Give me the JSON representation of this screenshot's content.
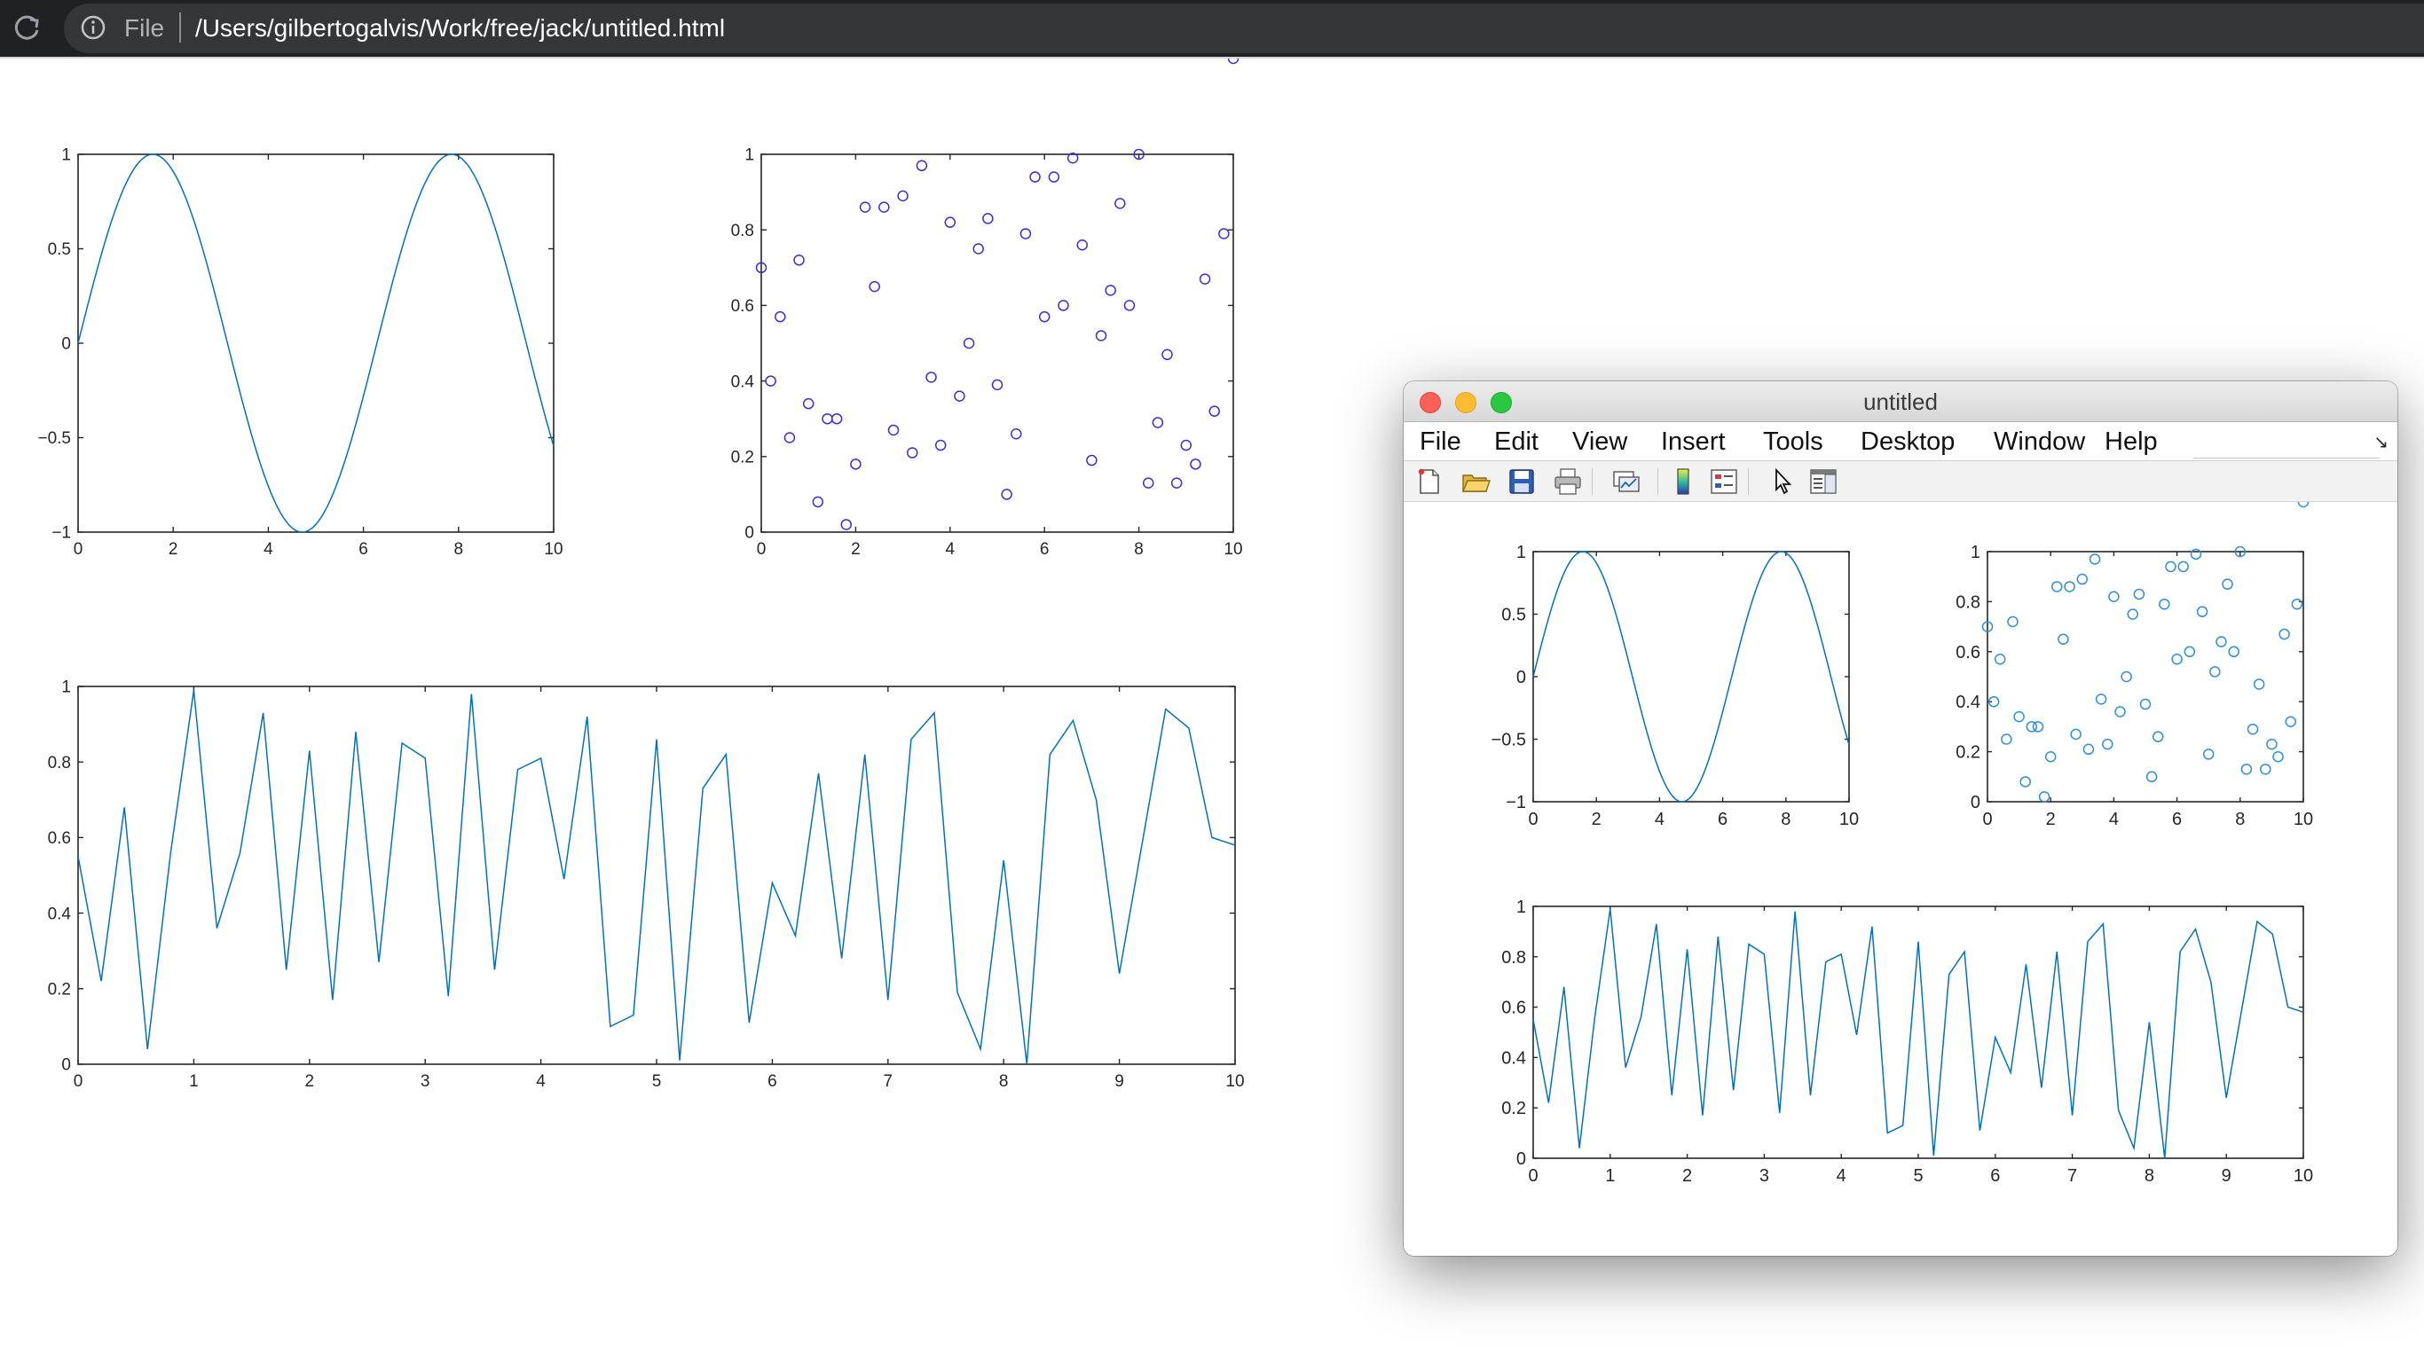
{
  "browser": {
    "scheme_label": "File",
    "url": "/Users/gilbertogalvis/Work/free/jack/untitled.html"
  },
  "figure_window": {
    "title": "untitled",
    "menu": [
      "File",
      "Edit",
      "View",
      "Insert",
      "Tools",
      "Desktop",
      "Window",
      "Help"
    ],
    "toolbar_icons": [
      "new-figure-icon",
      "open-file-icon",
      "save-icon",
      "print-icon",
      "link-plot-icon",
      "colorbar-icon",
      "legend-icon",
      "pointer-icon",
      "property-inspector-icon"
    ],
    "dock_symbol": "↘"
  },
  "colors": {
    "matlab_blue": "#0072bd",
    "scatter_html": "#3b2fd6",
    "scatter_matlab": "#2f8fd6"
  },
  "chart_data": [
    {
      "type": "line",
      "title": "",
      "xlabel": "",
      "ylabel": "",
      "xlim": [
        0,
        10
      ],
      "ylim": [
        -1,
        1
      ],
      "xticks": [
        0,
        2,
        4,
        6,
        8,
        10
      ],
      "yticks": [
        -1,
        -0.5,
        0,
        0.5,
        1
      ],
      "ytick_labels": [
        "−1",
        "−0.5",
        "0",
        "0.5",
        "1"
      ],
      "function": "y = sin(x)",
      "series": [
        {
          "x_start": 0,
          "x_end": 10,
          "samples": 201
        }
      ]
    },
    {
      "type": "scatter",
      "title": "",
      "xlabel": "",
      "ylabel": "",
      "xlim": [
        0,
        10
      ],
      "ylim": [
        0,
        1
      ],
      "xticks": [
        0,
        2,
        4,
        6,
        8,
        10
      ],
      "yticks": [
        0,
        0.2,
        0.4,
        0.6,
        0.8,
        1
      ],
      "ytick_labels": [
        "0",
        "0.2",
        "0.4",
        "0.6",
        "0.8",
        "1"
      ],
      "marker": "o",
      "x": [
        0,
        0.2,
        0.4,
        0.6,
        0.8,
        1.0,
        1.2,
        1.4,
        1.6,
        1.8,
        2.0,
        2.2,
        2.4,
        2.6,
        2.8,
        3.0,
        3.2,
        3.4,
        3.6,
        3.8,
        4.0,
        4.2,
        4.4,
        4.6,
        4.8,
        5.0,
        5.2,
        5.4,
        5.6,
        5.8,
        6.0,
        6.2,
        6.4,
        6.6,
        6.8,
        7.0,
        7.2,
        7.4,
        7.6,
        7.8,
        8.0,
        8.2,
        8.4,
        8.6,
        8.8,
        9.0,
        9.2,
        9.4,
        9.6,
        9.8,
        10.0
      ],
      "y": [
        0.7,
        0.4,
        0.57,
        0.25,
        0.72,
        0.34,
        0.08,
        0.3,
        0.3,
        0.02,
        0.18,
        0.86,
        0.65,
        0.86,
        0.27,
        0.89,
        0.21,
        0.97,
        0.41,
        0.23,
        0.82,
        0.36,
        0.5,
        0.75,
        0.83,
        0.39,
        0.1,
        0.26,
        0.79,
        0.94,
        0.57,
        0.94,
        0.6,
        0.99,
        0.76,
        0.19,
        0.52,
        0.64,
        0.87,
        0.6,
        1.0,
        0.13,
        0.29,
        0.47,
        0.13,
        0.23,
        0.18,
        0.67,
        0.32,
        0.79
      ]
    },
    {
      "type": "line",
      "title": "",
      "xlabel": "",
      "ylabel": "",
      "xlim": [
        0,
        10
      ],
      "ylim": [
        0,
        1
      ],
      "xticks": [
        0,
        1,
        2,
        3,
        4,
        5,
        6,
        7,
        8,
        9,
        10
      ],
      "yticks": [
        0,
        0.2,
        0.4,
        0.6,
        0.8,
        1
      ],
      "ytick_labels": [
        "0",
        "0.2",
        "0.4",
        "0.6",
        "0.8",
        "1"
      ],
      "x": [
        0,
        0.2,
        0.4,
        0.6,
        0.8,
        1.0,
        1.2,
        1.4,
        1.6,
        1.8,
        2.0,
        2.2,
        2.4,
        2.6,
        2.8,
        3.0,
        3.2,
        3.4,
        3.6,
        3.8,
        4.0,
        4.2,
        4.4,
        4.6,
        4.8,
        5.0,
        5.2,
        5.4,
        5.6,
        5.8,
        6.0,
        6.2,
        6.4,
        6.6,
        6.8,
        7.0,
        7.2,
        7.4,
        7.6,
        7.8,
        8.0,
        8.2,
        8.4,
        8.6,
        8.8,
        9.0,
        9.2,
        9.4,
        9.6,
        9.8,
        10.0
      ],
      "y": [
        0.55,
        0.22,
        0.68,
        0.04,
        0.56,
        0.99,
        0.36,
        0.56,
        0.93,
        0.25,
        0.83,
        0.17,
        0.88,
        0.27,
        0.85,
        0.81,
        0.18,
        0.98,
        0.25,
        0.78,
        0.81,
        0.49,
        0.92,
        0.1,
        0.13,
        0.86,
        0.01,
        0.73,
        0.82,
        0.11,
        0.48,
        0.34,
        0.77,
        0.28,
        0.82,
        0.17,
        0.86,
        0.93,
        0.19,
        0.04,
        0.54,
        0.0,
        0.82,
        0.91,
        0.7,
        0.24,
        0.59,
        0.94,
        0.89,
        0.6,
        0.58
      ]
    }
  ]
}
